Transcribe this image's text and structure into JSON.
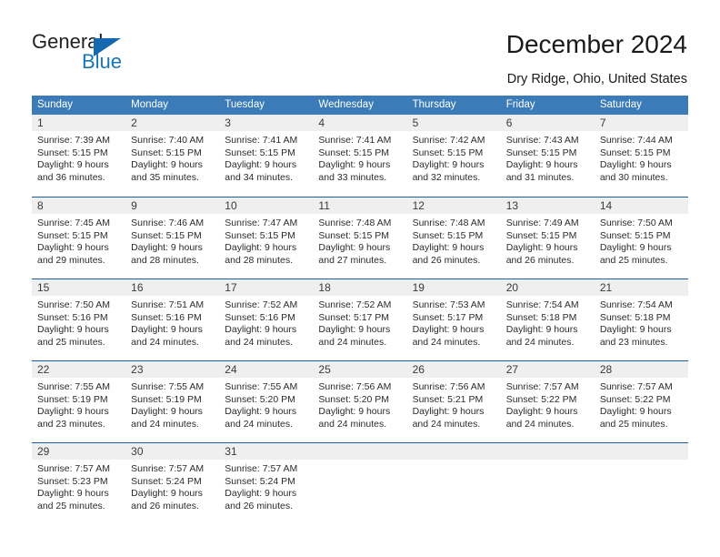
{
  "brand": {
    "name_top": "General",
    "name_bottom": "Blue",
    "accent_color": "#1775bb",
    "triangle_color": "#1468b0"
  },
  "header": {
    "title": "December 2024",
    "subtitle": "Dry Ridge, Ohio, United States"
  },
  "calendar": {
    "header_bg": "#3b7cb8",
    "row_divider_color": "#1a5da0",
    "day_band_bg": "#efefef",
    "weekdays": [
      "Sunday",
      "Monday",
      "Tuesday",
      "Wednesday",
      "Thursday",
      "Friday",
      "Saturday"
    ],
    "weeks": [
      [
        {
          "day": "1",
          "sunrise": "Sunrise: 7:39 AM",
          "sunset": "Sunset: 5:15 PM",
          "daylight_line1": "Daylight: 9 hours",
          "daylight_line2": "and 36 minutes."
        },
        {
          "day": "2",
          "sunrise": "Sunrise: 7:40 AM",
          "sunset": "Sunset: 5:15 PM",
          "daylight_line1": "Daylight: 9 hours",
          "daylight_line2": "and 35 minutes."
        },
        {
          "day": "3",
          "sunrise": "Sunrise: 7:41 AM",
          "sunset": "Sunset: 5:15 PM",
          "daylight_line1": "Daylight: 9 hours",
          "daylight_line2": "and 34 minutes."
        },
        {
          "day": "4",
          "sunrise": "Sunrise: 7:41 AM",
          "sunset": "Sunset: 5:15 PM",
          "daylight_line1": "Daylight: 9 hours",
          "daylight_line2": "and 33 minutes."
        },
        {
          "day": "5",
          "sunrise": "Sunrise: 7:42 AM",
          "sunset": "Sunset: 5:15 PM",
          "daylight_line1": "Daylight: 9 hours",
          "daylight_line2": "and 32 minutes."
        },
        {
          "day": "6",
          "sunrise": "Sunrise: 7:43 AM",
          "sunset": "Sunset: 5:15 PM",
          "daylight_line1": "Daylight: 9 hours",
          "daylight_line2": "and 31 minutes."
        },
        {
          "day": "7",
          "sunrise": "Sunrise: 7:44 AM",
          "sunset": "Sunset: 5:15 PM",
          "daylight_line1": "Daylight: 9 hours",
          "daylight_line2": "and 30 minutes."
        }
      ],
      [
        {
          "day": "8",
          "sunrise": "Sunrise: 7:45 AM",
          "sunset": "Sunset: 5:15 PM",
          "daylight_line1": "Daylight: 9 hours",
          "daylight_line2": "and 29 minutes."
        },
        {
          "day": "9",
          "sunrise": "Sunrise: 7:46 AM",
          "sunset": "Sunset: 5:15 PM",
          "daylight_line1": "Daylight: 9 hours",
          "daylight_line2": "and 28 minutes."
        },
        {
          "day": "10",
          "sunrise": "Sunrise: 7:47 AM",
          "sunset": "Sunset: 5:15 PM",
          "daylight_line1": "Daylight: 9 hours",
          "daylight_line2": "and 28 minutes."
        },
        {
          "day": "11",
          "sunrise": "Sunrise: 7:48 AM",
          "sunset": "Sunset: 5:15 PM",
          "daylight_line1": "Daylight: 9 hours",
          "daylight_line2": "and 27 minutes."
        },
        {
          "day": "12",
          "sunrise": "Sunrise: 7:48 AM",
          "sunset": "Sunset: 5:15 PM",
          "daylight_line1": "Daylight: 9 hours",
          "daylight_line2": "and 26 minutes."
        },
        {
          "day": "13",
          "sunrise": "Sunrise: 7:49 AM",
          "sunset": "Sunset: 5:15 PM",
          "daylight_line1": "Daylight: 9 hours",
          "daylight_line2": "and 26 minutes."
        },
        {
          "day": "14",
          "sunrise": "Sunrise: 7:50 AM",
          "sunset": "Sunset: 5:15 PM",
          "daylight_line1": "Daylight: 9 hours",
          "daylight_line2": "and 25 minutes."
        }
      ],
      [
        {
          "day": "15",
          "sunrise": "Sunrise: 7:50 AM",
          "sunset": "Sunset: 5:16 PM",
          "daylight_line1": "Daylight: 9 hours",
          "daylight_line2": "and 25 minutes."
        },
        {
          "day": "16",
          "sunrise": "Sunrise: 7:51 AM",
          "sunset": "Sunset: 5:16 PM",
          "daylight_line1": "Daylight: 9 hours",
          "daylight_line2": "and 24 minutes."
        },
        {
          "day": "17",
          "sunrise": "Sunrise: 7:52 AM",
          "sunset": "Sunset: 5:16 PM",
          "daylight_line1": "Daylight: 9 hours",
          "daylight_line2": "and 24 minutes."
        },
        {
          "day": "18",
          "sunrise": "Sunrise: 7:52 AM",
          "sunset": "Sunset: 5:17 PM",
          "daylight_line1": "Daylight: 9 hours",
          "daylight_line2": "and 24 minutes."
        },
        {
          "day": "19",
          "sunrise": "Sunrise: 7:53 AM",
          "sunset": "Sunset: 5:17 PM",
          "daylight_line1": "Daylight: 9 hours",
          "daylight_line2": "and 24 minutes."
        },
        {
          "day": "20",
          "sunrise": "Sunrise: 7:54 AM",
          "sunset": "Sunset: 5:18 PM",
          "daylight_line1": "Daylight: 9 hours",
          "daylight_line2": "and 24 minutes."
        },
        {
          "day": "21",
          "sunrise": "Sunrise: 7:54 AM",
          "sunset": "Sunset: 5:18 PM",
          "daylight_line1": "Daylight: 9 hours",
          "daylight_line2": "and 23 minutes."
        }
      ],
      [
        {
          "day": "22",
          "sunrise": "Sunrise: 7:55 AM",
          "sunset": "Sunset: 5:19 PM",
          "daylight_line1": "Daylight: 9 hours",
          "daylight_line2": "and 23 minutes."
        },
        {
          "day": "23",
          "sunrise": "Sunrise: 7:55 AM",
          "sunset": "Sunset: 5:19 PM",
          "daylight_line1": "Daylight: 9 hours",
          "daylight_line2": "and 24 minutes."
        },
        {
          "day": "24",
          "sunrise": "Sunrise: 7:55 AM",
          "sunset": "Sunset: 5:20 PM",
          "daylight_line1": "Daylight: 9 hours",
          "daylight_line2": "and 24 minutes."
        },
        {
          "day": "25",
          "sunrise": "Sunrise: 7:56 AM",
          "sunset": "Sunset: 5:20 PM",
          "daylight_line1": "Daylight: 9 hours",
          "daylight_line2": "and 24 minutes."
        },
        {
          "day": "26",
          "sunrise": "Sunrise: 7:56 AM",
          "sunset": "Sunset: 5:21 PM",
          "daylight_line1": "Daylight: 9 hours",
          "daylight_line2": "and 24 minutes."
        },
        {
          "day": "27",
          "sunrise": "Sunrise: 7:57 AM",
          "sunset": "Sunset: 5:22 PM",
          "daylight_line1": "Daylight: 9 hours",
          "daylight_line2": "and 24 minutes."
        },
        {
          "day": "28",
          "sunrise": "Sunrise: 7:57 AM",
          "sunset": "Sunset: 5:22 PM",
          "daylight_line1": "Daylight: 9 hours",
          "daylight_line2": "and 25 minutes."
        }
      ],
      [
        {
          "day": "29",
          "sunrise": "Sunrise: 7:57 AM",
          "sunset": "Sunset: 5:23 PM",
          "daylight_line1": "Daylight: 9 hours",
          "daylight_line2": "and 25 minutes."
        },
        {
          "day": "30",
          "sunrise": "Sunrise: 7:57 AM",
          "sunset": "Sunset: 5:24 PM",
          "daylight_line1": "Daylight: 9 hours",
          "daylight_line2": "and 26 minutes."
        },
        {
          "day": "31",
          "sunrise": "Sunrise: 7:57 AM",
          "sunset": "Sunset: 5:24 PM",
          "daylight_line1": "Daylight: 9 hours",
          "daylight_line2": "and 26 minutes."
        },
        {
          "day": "",
          "sunrise": "",
          "sunset": "",
          "daylight_line1": "",
          "daylight_line2": ""
        },
        {
          "day": "",
          "sunrise": "",
          "sunset": "",
          "daylight_line1": "",
          "daylight_line2": ""
        },
        {
          "day": "",
          "sunrise": "",
          "sunset": "",
          "daylight_line1": "",
          "daylight_line2": ""
        },
        {
          "day": "",
          "sunrise": "",
          "sunset": "",
          "daylight_line1": "",
          "daylight_line2": ""
        }
      ]
    ]
  }
}
